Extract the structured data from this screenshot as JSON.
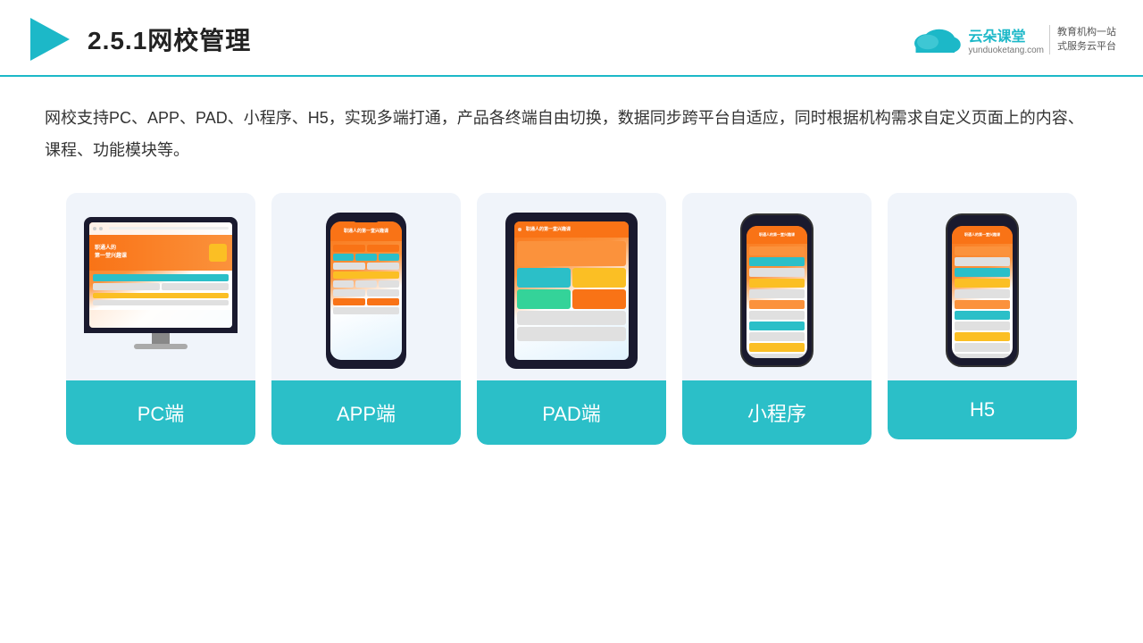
{
  "header": {
    "title": "2.5.1网校管理",
    "logo": {
      "brand": "云朵课堂",
      "url": "yunduoketang.com",
      "tagline": "教育机构一站\n式服务云平台"
    }
  },
  "description": "网校支持PC、APP、PAD、小程序、H5，实现多端打通，产品各终端自由切换，数据同步跨平台自适应，同时根据机构需求自定义页面上的内容、课程、功能模块等。",
  "cards": [
    {
      "id": "pc",
      "label": "PC端"
    },
    {
      "id": "app",
      "label": "APP端"
    },
    {
      "id": "pad",
      "label": "PAD端"
    },
    {
      "id": "mini",
      "label": "小程序"
    },
    {
      "id": "h5",
      "label": "H5"
    }
  ]
}
